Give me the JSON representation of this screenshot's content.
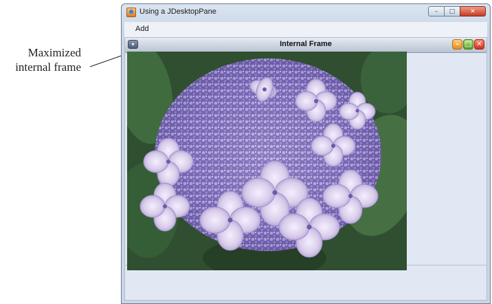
{
  "callout": {
    "line1": "Maximized",
    "line2": "internal frame"
  },
  "window": {
    "title": "Using a JDesktopPane",
    "app_icon": "java-cup-icon",
    "buttons": {
      "minimize": "–",
      "maximize": "□",
      "close": "✕"
    }
  },
  "menubar": {
    "items": [
      "Add"
    ]
  },
  "internal_frame": {
    "title": "Internal Frame",
    "system_menu_icon": "frame-menu-icon",
    "buttons": {
      "minimize": "–",
      "maximize": "□",
      "close": "✕"
    }
  },
  "image": {
    "subject": "hydrangea-photo",
    "colors": {
      "flower_light": "#d9cdea",
      "flower_mid": "#9a86c7",
      "flower_dark": "#5e4e9a",
      "leaf": "#3f6b3f",
      "leaf_dark": "#243f28"
    }
  }
}
